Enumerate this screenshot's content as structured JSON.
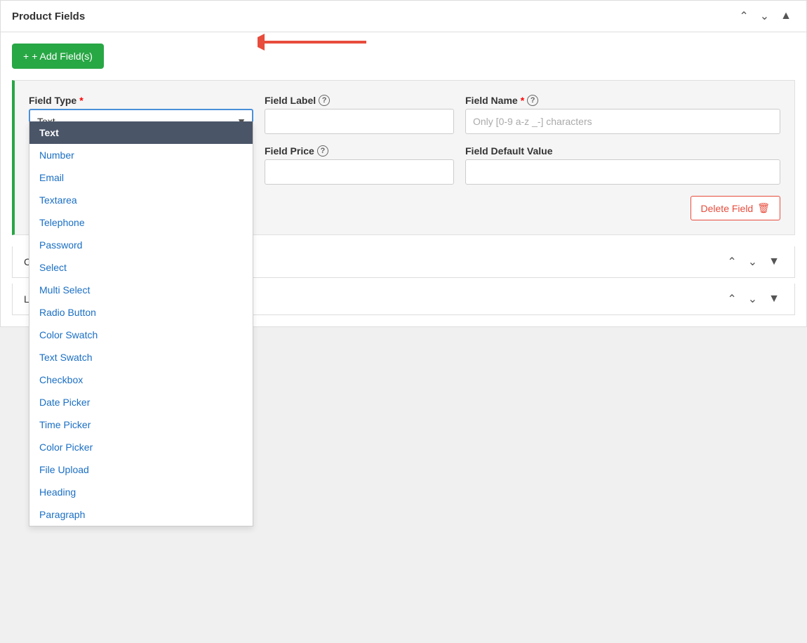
{
  "header": {
    "title": "Product Fields",
    "controls": [
      "up-arrow",
      "down-arrow",
      "expand-icon"
    ]
  },
  "add_field_button": "+ Add Field(s)",
  "field_row": {
    "field_type_label": "Field Type",
    "field_type_required": true,
    "field_type_selected": "Text",
    "field_label_label": "Field Label",
    "field_label_help": true,
    "field_name_label": "Field Name",
    "field_name_required": true,
    "field_name_help": true,
    "field_name_placeholder": "Only [0-9 a-z _-] characters",
    "field_price_label": "Field Price",
    "field_price_help": true,
    "field_default_value_label": "Field Default Value",
    "delete_button": "Delete Field"
  },
  "dropdown_options": [
    {
      "label": "Text",
      "selected": true
    },
    {
      "label": "Number",
      "selected": false
    },
    {
      "label": "Email",
      "selected": false
    },
    {
      "label": "Textarea",
      "selected": false
    },
    {
      "label": "Telephone",
      "selected": false
    },
    {
      "label": "Password",
      "selected": false
    },
    {
      "label": "Select",
      "selected": false
    },
    {
      "label": "Multi Select",
      "selected": false
    },
    {
      "label": "Radio Button",
      "selected": false
    },
    {
      "label": "Color Swatch",
      "selected": false
    },
    {
      "label": "Text Swatch",
      "selected": false
    },
    {
      "label": "Checkbox",
      "selected": false
    },
    {
      "label": "Date Picker",
      "selected": false
    },
    {
      "label": "Time Picker",
      "selected": false
    },
    {
      "label": "Color Picker",
      "selected": false
    },
    {
      "label": "File Upload",
      "selected": false
    },
    {
      "label": "Heading",
      "selected": false
    },
    {
      "label": "Paragraph",
      "selected": false
    }
  ],
  "collapsed_sections": [
    {
      "title": "Co"
    },
    {
      "title": "Lab"
    }
  ],
  "arrow_indicator": "←"
}
